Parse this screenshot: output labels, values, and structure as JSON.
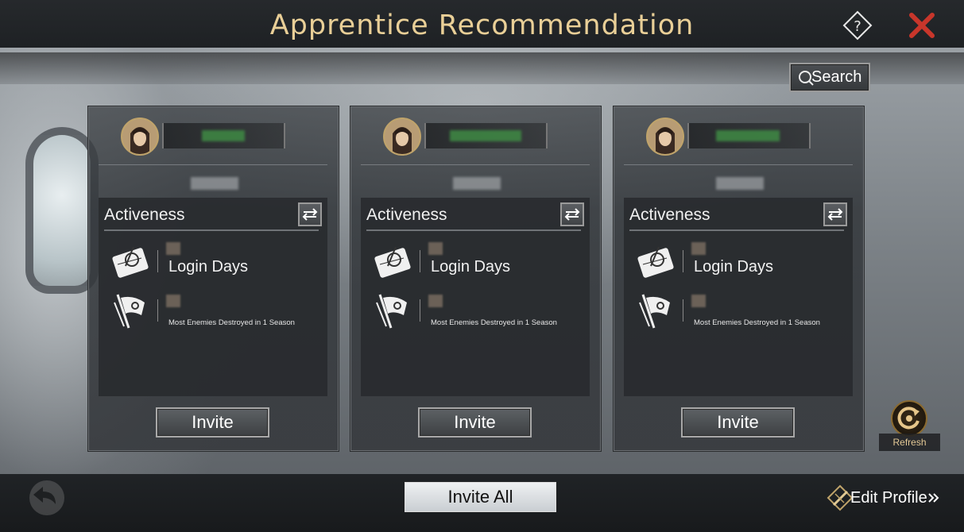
{
  "header": {
    "title": "Apprentice Recommendation"
  },
  "search": {
    "label": "Search"
  },
  "cards": [
    {
      "activeness_label": "Activeness",
      "login_label": "Login Days",
      "enemies_label": "Most Enemies Destroyed in 1 Season",
      "invite_label": "Invite"
    },
    {
      "activeness_label": "Activeness",
      "login_label": "Login Days",
      "enemies_label": "Most Enemies Destroyed in 1 Season",
      "invite_label": "Invite"
    },
    {
      "activeness_label": "Activeness",
      "login_label": "Login Days",
      "enemies_label": "Most Enemies Destroyed in 1 Season",
      "invite_label": "Invite"
    }
  ],
  "refresh": {
    "label": "Refresh"
  },
  "footer": {
    "invite_all_label": "Invite All",
    "edit_profile_label": "Edit Profile"
  },
  "colors": {
    "title_gold": "#e9cf97",
    "close_red": "#c8362b",
    "panel_dark": "#282a2d"
  }
}
